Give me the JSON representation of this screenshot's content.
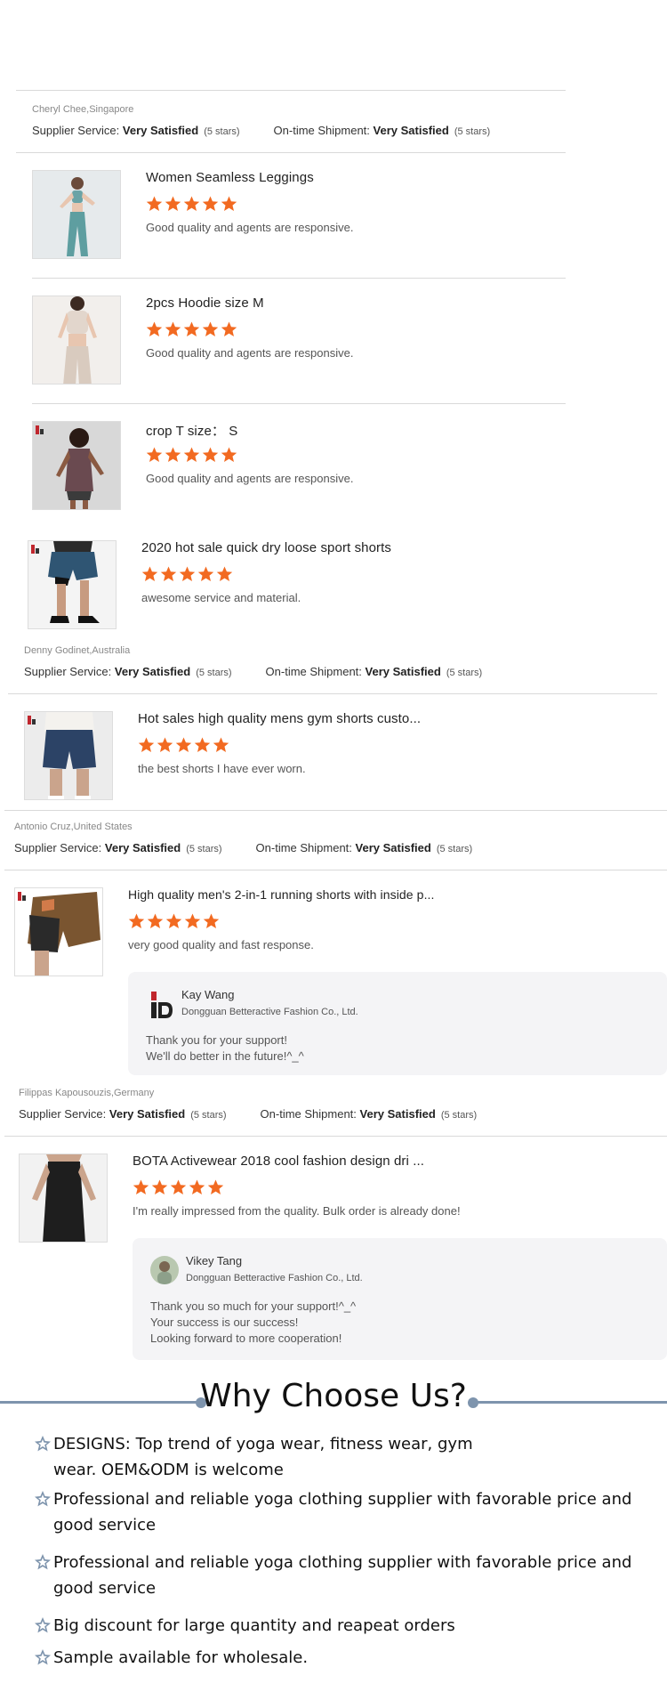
{
  "colors": {
    "star": "#f26a21",
    "accent_line": "#7e94ad"
  },
  "labels": {
    "supplier_service": "Supplier Service:",
    "ontime_shipment": "On-time Shipment:",
    "very_satisfied": "Very Satisfied",
    "five_stars": "(5 stars)"
  },
  "reviews": [
    {
      "reviewer": "Cheryl Chee,Singapore",
      "products": [
        {
          "title": "Women Seamless Leggings",
          "rating": 5,
          "comment": "Good quality and agents are responsive.",
          "image": "woman-in-teal-leggings"
        },
        {
          "title": "2pcs Hoodie size M",
          "rating": 5,
          "comment": "Good quality and agents are responsive.",
          "image": "woman-in-beige-set"
        },
        {
          "title": "crop T size： S",
          "rating": 5,
          "comment": "Good quality and agents are responsive.",
          "image": "woman-in-tank-top"
        }
      ]
    },
    {
      "reviewer": "Denny Godinet,Australia",
      "products": [
        {
          "title": "2020 hot sale quick dry loose sport shorts",
          "rating": 5,
          "comment": "awesome service and material.",
          "image": "man-in-sport-shorts"
        }
      ]
    },
    {
      "reviewer": "Antonio Cruz,United States",
      "products": [
        {
          "title": "Hot sales high quality mens gym shorts custo...",
          "rating": 5,
          "comment": "the best shorts I have ever worn.",
          "image": "man-in-navy-shorts"
        }
      ]
    },
    {
      "reviewer": "Filippas Kapousouzis,Germany",
      "products": [
        {
          "title": "High quality men's 2-in-1 running shorts with inside p...",
          "rating": 5,
          "comment": "very good quality and fast response.",
          "image": "brown-running-shorts"
        }
      ],
      "reply": {
        "name": "Kay Wang",
        "company": "Dongguan Betteractive Fashion Co., Ltd.",
        "text": "Thank you for your support!\nWe'll do better in the future!^_^"
      }
    },
    {
      "reviewer": "",
      "products": [
        {
          "title": "BOTA Activewear 2018 cool fashion design dri ...",
          "rating": 5,
          "comment": "I'm really impressed from the quality. Bulk order is already done!",
          "image": "man-in-black-tank"
        }
      ],
      "reply": {
        "name": "Vikey Tang",
        "company": "Dongguan Betteractive Fashion Co., Ltd.",
        "text": "Thank you so much for your support!^_^\nYour success is our success!\nLooking forward to more cooperation!"
      }
    }
  ],
  "why": {
    "title": "Why Choose Us?",
    "items": [
      "DESIGNS: Top trend of yoga wear, fitness wear, gym wear. OEM&ODM is welcome",
      "Professional and reliable yoga clothing supplier with favorable price and good service",
      "Professional and reliable yoga clothing supplier with favorable price and good service",
      "Big discount for large quantity and reapeat orders",
      "Sample available for wholesale."
    ]
  }
}
